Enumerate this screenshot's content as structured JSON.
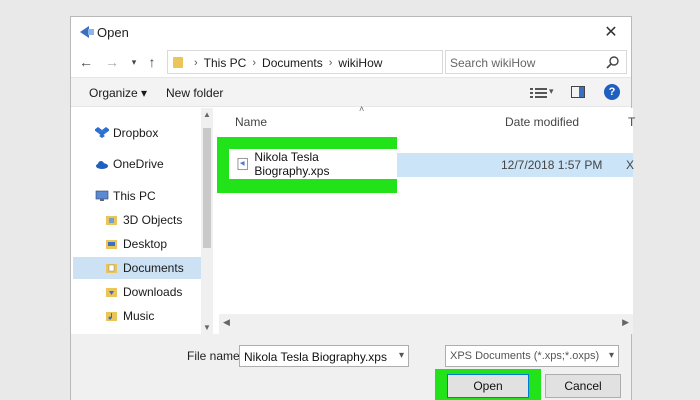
{
  "window": {
    "title": "Open"
  },
  "address": {
    "crumbs": [
      "This PC",
      "Documents",
      "wikiHow"
    ],
    "search_placeholder": "Search wikiHow"
  },
  "commands": {
    "organize": "Organize ▾",
    "new_folder": "New folder"
  },
  "nav": {
    "items": [
      {
        "label": "Dropbox",
        "icon": "dropbox-icon"
      },
      {
        "label": "OneDrive",
        "icon": "cloud-icon"
      },
      {
        "label": "This PC",
        "icon": "computer-icon"
      },
      {
        "label": "3D Objects",
        "icon": "cube-folder-icon"
      },
      {
        "label": "Desktop",
        "icon": "desktop-folder-icon"
      },
      {
        "label": "Documents",
        "icon": "documents-folder-icon",
        "selected": true
      },
      {
        "label": "Downloads",
        "icon": "downloads-folder-icon"
      },
      {
        "label": "Music",
        "icon": "music-folder-icon"
      }
    ]
  },
  "columns": {
    "name": "Name",
    "date": "Date modified",
    "type": "T"
  },
  "files": [
    {
      "name": "Nikola Tesla Biography.xps",
      "date": "12/7/2018 1:57 PM",
      "type": "X"
    }
  ],
  "bottom": {
    "file_name_label": "File name:",
    "file_name_value": "Nikola Tesla Biography.xps",
    "file_type_value": "XPS Documents (*.xps;*.oxps)",
    "open_label": "Open",
    "cancel_label": "Cancel"
  },
  "colors": {
    "highlight": "#22e31a",
    "accent": "#0078d7",
    "selection": "#cce4f7"
  }
}
